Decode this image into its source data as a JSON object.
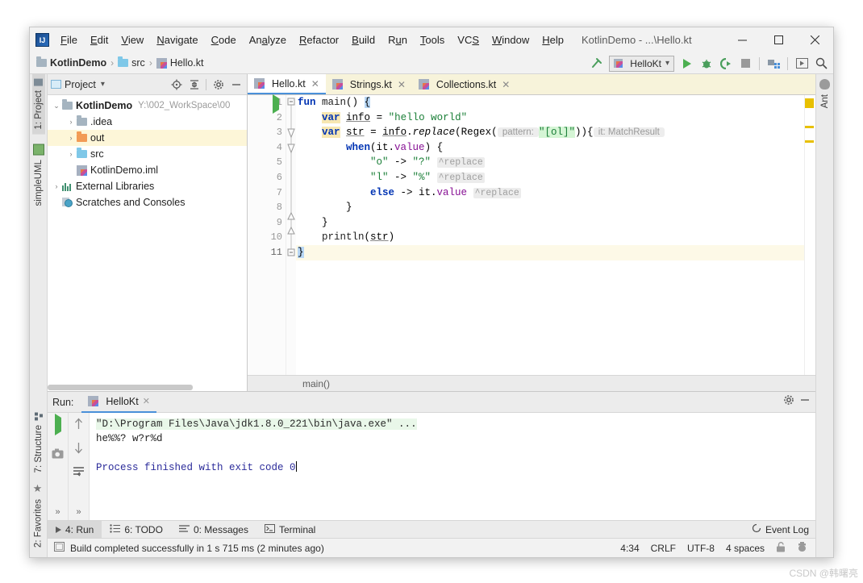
{
  "window": {
    "app_icon": "IJ",
    "title": "KotlinDemo - ...\\Hello.kt",
    "minimize": "—",
    "maximize": "▢",
    "close": "✕"
  },
  "menubar": [
    {
      "label": "File",
      "mnemonic": "F"
    },
    {
      "label": "Edit",
      "mnemonic": "E"
    },
    {
      "label": "View",
      "mnemonic": "V"
    },
    {
      "label": "Navigate",
      "mnemonic": "N"
    },
    {
      "label": "Code",
      "mnemonic": "C"
    },
    {
      "label": "Analyze",
      "mnemonic": "A"
    },
    {
      "label": "Refactor",
      "mnemonic": "R"
    },
    {
      "label": "Build",
      "mnemonic": "B"
    },
    {
      "label": "Run",
      "mnemonic": "R"
    },
    {
      "label": "Tools",
      "mnemonic": "T"
    },
    {
      "label": "VCS",
      "mnemonic": "V"
    },
    {
      "label": "Window",
      "mnemonic": "W"
    },
    {
      "label": "Help",
      "mnemonic": "H"
    }
  ],
  "navbar": {
    "crumbs": [
      {
        "label": "KotlinDemo",
        "icon": "module-folder-icon",
        "bold": true
      },
      {
        "label": "src",
        "icon": "source-folder-icon",
        "bold": false
      },
      {
        "label": "Hello.kt",
        "icon": "kotlin-file-icon",
        "bold": false
      }
    ],
    "separator": "›",
    "run_config": "HelloKt",
    "run_config_caret": "⌄",
    "icons": [
      "build-hammer-icon",
      "run-icon",
      "debug-icon",
      "run-coverage-icon",
      "stop-icon",
      "project-structure-icon",
      "update-icon",
      "search-everywhere-icon"
    ]
  },
  "left_rail": [
    {
      "label": "1: Project",
      "mnemonic": "1",
      "active": true,
      "icon": "project-icon"
    },
    {
      "label": "simpleUML",
      "active": false,
      "icon": "uml-icon"
    },
    {
      "label": "7: Structure",
      "mnemonic": "7",
      "active": false,
      "icon": "structure-icon"
    },
    {
      "label": "2: Favorites",
      "mnemonic": "2",
      "active": false,
      "icon": "star-icon"
    }
  ],
  "right_rail": [
    {
      "label": "Ant",
      "active": false,
      "icon": "ant-icon"
    }
  ],
  "project_pane": {
    "title": "Project",
    "caret": "▾",
    "header_icons": [
      "locate-icon",
      "collapse-all-icon",
      "settings-gear-icon",
      "hide-icon"
    ],
    "tree": [
      {
        "indent": 0,
        "arrow": "⌄",
        "icon": "module-folder-icon",
        "label": "KotlinDemo",
        "bold": true,
        "path": "Y:\\002_WorkSpace\\00",
        "highlight": false
      },
      {
        "indent": 1,
        "arrow": "›",
        "icon": "gray-folder-icon",
        "label": ".idea",
        "bold": false,
        "path": "",
        "highlight": false
      },
      {
        "indent": 1,
        "arrow": "›",
        "icon": "orange-folder-icon",
        "label": "out",
        "bold": false,
        "path": "",
        "highlight": true
      },
      {
        "indent": 1,
        "arrow": "›",
        "icon": "blue-folder-icon",
        "label": "src",
        "bold": false,
        "path": "",
        "highlight": false
      },
      {
        "indent": 1,
        "arrow": "",
        "icon": "iml-file-icon",
        "label": "KotlinDemo.iml",
        "bold": false,
        "path": "",
        "highlight": false
      },
      {
        "indent": 0,
        "arrow": "›",
        "icon": "external-libraries-icon",
        "label": "External Libraries",
        "bold": false,
        "path": "",
        "highlight": false
      },
      {
        "indent": 0,
        "arrow": "",
        "icon": "scratches-icon",
        "label": "Scratches and Consoles",
        "bold": false,
        "path": "",
        "highlight": false
      }
    ]
  },
  "editor": {
    "tabs": [
      {
        "label": "Hello.kt",
        "active": true,
        "close": "✕",
        "icon": "kotlin-file-icon"
      },
      {
        "label": "Strings.kt",
        "active": false,
        "close": "✕",
        "icon": "kotlin-file-icon"
      },
      {
        "label": "Collections.kt",
        "active": false,
        "close": "✕",
        "icon": "kotlin-file-icon"
      }
    ],
    "line_numbers": [
      "1",
      "2",
      "3",
      "4",
      "5",
      "6",
      "7",
      "8",
      "9",
      "10",
      "11"
    ],
    "current_line": 11,
    "breadcrumb": "main()",
    "code_lines": [
      {
        "n": 1,
        "text": "fun main() {"
      },
      {
        "n": 2,
        "text": "    var info = \"hello world\""
      },
      {
        "n": 3,
        "text": "    var str = info.replace(Regex( pattern: \"[ol]\")){ it: MatchResult"
      },
      {
        "n": 4,
        "text": "        when(it.value) {"
      },
      {
        "n": 5,
        "text": "            \"o\" -> \"?\" ^replace"
      },
      {
        "n": 6,
        "text": "            \"l\" -> \"%\" ^replace"
      },
      {
        "n": 7,
        "text": "            else -> it.value ^replace"
      },
      {
        "n": 8,
        "text": "        }"
      },
      {
        "n": 9,
        "text": "    }"
      },
      {
        "n": 10,
        "text": "    println(str)"
      },
      {
        "n": 11,
        "text": "}"
      }
    ],
    "inlay_hints": [
      "pattern:",
      "it: MatchResult"
    ],
    "lambda_labels": [
      "^replace"
    ],
    "marker_color": "#e8c000"
  },
  "run_pane": {
    "label": "Run:",
    "tab": "HelloKt",
    "tab_close": "✕",
    "toolbar_icons": [
      "rerun-icon",
      "stop-icon",
      "screenshot-icon",
      "scroll-up-icon",
      "scroll-down-icon",
      "soft-wrap-icon",
      "expand-icon"
    ],
    "header_icons": [
      "settings-gear-icon",
      "hide-icon"
    ],
    "console": [
      {
        "text": "\"D:\\Program Files\\Java\\jdk1.8.0_221\\bin\\java.exe\" ...",
        "style": "cmd"
      },
      {
        "text": "he%%? w?r%d",
        "style": "out"
      },
      {
        "text": "",
        "style": "out"
      },
      {
        "text": "Process finished with exit code 0",
        "style": "fin"
      }
    ]
  },
  "tool_strip": {
    "items": [
      {
        "label": "4: Run",
        "mnemonic": "4",
        "icon": "run-icon",
        "active": true
      },
      {
        "label": "6: TODO",
        "mnemonic": "6",
        "icon": "todo-icon",
        "active": false
      },
      {
        "label": "0: Messages",
        "mnemonic": "0",
        "icon": "messages-icon",
        "active": false
      },
      {
        "label": "Terminal",
        "mnemonic": "",
        "icon": "terminal-icon",
        "active": false
      }
    ],
    "event_log": "Event Log",
    "event_log_icon": "event-log-icon"
  },
  "statusbar": {
    "message": "Build completed successfully in 1 s 715 ms (2 minutes ago)",
    "message_icon": "build-status-icon",
    "caret_position": "4:34",
    "line_separator": "CRLF",
    "encoding": "UTF-8",
    "indent": "4 spaces",
    "lock_icon": "lock-icon",
    "inspector_icon": "inspector-icon"
  },
  "watermark": "CSDN @韩曙亮"
}
